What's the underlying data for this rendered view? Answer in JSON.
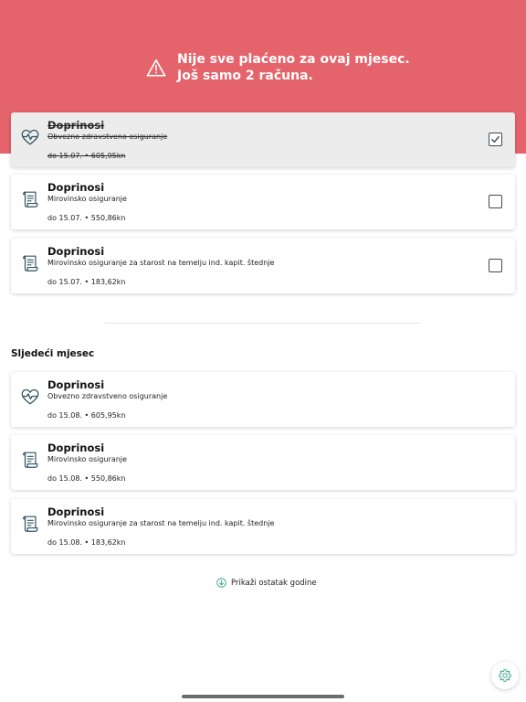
{
  "banner": {
    "line1": "Nije sve plaćeno za ovaj mjesec.",
    "line2": "Još samo 2 računa.",
    "icon": "warning-triangle-icon",
    "color": "#e5636b"
  },
  "current_month": {
    "items": [
      {
        "title": "Doprinosi",
        "subtitle": "Obvezno zdravstveno osiguranje",
        "meta": "do 15.07. • 605,95kn",
        "icon": "heart-pulse-icon",
        "paid": true
      },
      {
        "title": "Doprinosi",
        "subtitle": "Mirovinsko osiguranje",
        "meta": "do 15.07. • 550,86kn",
        "icon": "document-icon",
        "paid": false
      },
      {
        "title": "Doprinosi",
        "subtitle": "Mirovinsko osiguranje za starost na temelju ind. kapit. štednje",
        "meta": "do 15.07. • 183,62kn",
        "icon": "document-icon",
        "paid": false
      }
    ]
  },
  "next_month": {
    "title": "Sljedeći mjesec",
    "items": [
      {
        "title": "Doprinosi",
        "subtitle": "Obvezno zdravstveno osiguranje",
        "meta": "do 15.08. • 605,95kn",
        "icon": "heart-pulse-icon"
      },
      {
        "title": "Doprinosi",
        "subtitle": "Mirovinsko osiguranje",
        "meta": "do 15.08. • 550,86kn",
        "icon": "document-icon"
      },
      {
        "title": "Doprinosi",
        "subtitle": "Mirovinsko osiguranje za starost na temelju ind. kapit. štednje",
        "meta": "do 15.08. • 183,62kn",
        "icon": "document-icon"
      }
    ]
  },
  "show_more": {
    "label": "Prikaži ostatak godine",
    "icon": "arrow-down-circle-icon"
  },
  "settings": {
    "icon": "gear-icon"
  },
  "colors": {
    "icon_stroke": "#2f5361",
    "accent": "#3aa58c"
  }
}
